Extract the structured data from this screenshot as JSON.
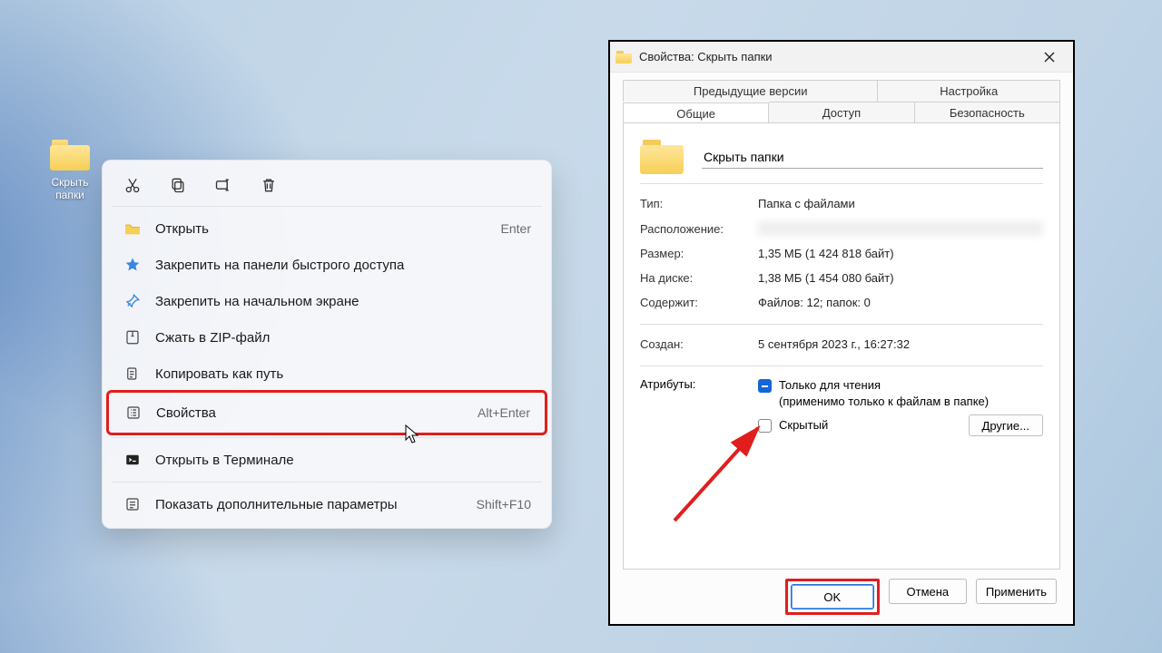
{
  "desktop": {
    "folder_label": "Скрыть\nпапки"
  },
  "context_menu": {
    "toolbar": {
      "cut": "cut",
      "copy": "copy",
      "rename": "rename",
      "delete": "delete"
    },
    "items": [
      {
        "label": "Открыть",
        "shortcut": "Enter"
      },
      {
        "label": "Закрепить на панели быстрого доступа",
        "shortcut": ""
      },
      {
        "label": "Закрепить на начальном экране",
        "shortcut": ""
      },
      {
        "label": "Сжать в ZIP-файл",
        "shortcut": ""
      },
      {
        "label": "Копировать как путь",
        "shortcut": ""
      },
      {
        "label": "Свойства",
        "shortcut": "Alt+Enter"
      },
      {
        "label": "Открыть в Терминале",
        "shortcut": ""
      },
      {
        "label": "Показать дополнительные параметры",
        "shortcut": "Shift+F10"
      }
    ]
  },
  "properties": {
    "title": "Свойства: Скрыть папки",
    "tabs_back": [
      "Предыдущие версии",
      "Настройка"
    ],
    "tabs_front": [
      "Общие",
      "Доступ",
      "Безопасность"
    ],
    "name_value": "Скрыть папки",
    "rows": {
      "type": {
        "k": "Тип:",
        "v": "Папка с файлами"
      },
      "location": {
        "k": "Расположение:",
        "v": ""
      },
      "size": {
        "k": "Размер:",
        "v": "1,35 МБ (1 424 818 байт)"
      },
      "size_on_disk": {
        "k": "На диске:",
        "v": "1,38 МБ (1 454 080 байт)"
      },
      "contains": {
        "k": "Содержит:",
        "v": "Файлов: 12; папок: 0"
      },
      "created": {
        "k": "Создан:",
        "v": "5 сентября 2023 г., 16:27:32"
      }
    },
    "attributes": {
      "label": "Атрибуты:",
      "readonly": "Только для чтения",
      "readonly_sub": "(применимо только к файлам в папке)",
      "hidden": "Скрытый",
      "other_btn": "Другие..."
    },
    "buttons": {
      "ok": "OK",
      "cancel": "Отмена",
      "apply": "Применить"
    }
  }
}
